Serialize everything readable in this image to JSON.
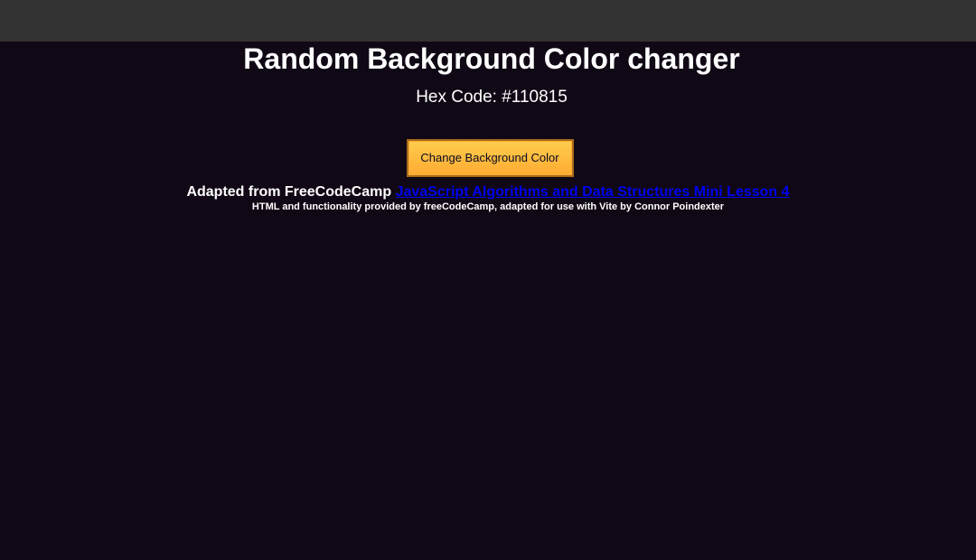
{
  "page": {
    "title": "Random Background Color changer",
    "hex_prefix": "Hex Code: ",
    "hex_value": "#110815",
    "button_label": "Change Background Color",
    "credit_prefix": "Adapted from FreeCodeCamp ",
    "credit_link_text": "JavaScript Algorithms and Data Structures Mini Lesson 4",
    "footnote": "HTML and functionality provided by freeCodeCamp, adapted for use with Vite by Connor Poindexter"
  },
  "colors": {
    "background": "#110815",
    "top_bar": "#333333",
    "button": "#feac32",
    "link": "#0000ee"
  }
}
